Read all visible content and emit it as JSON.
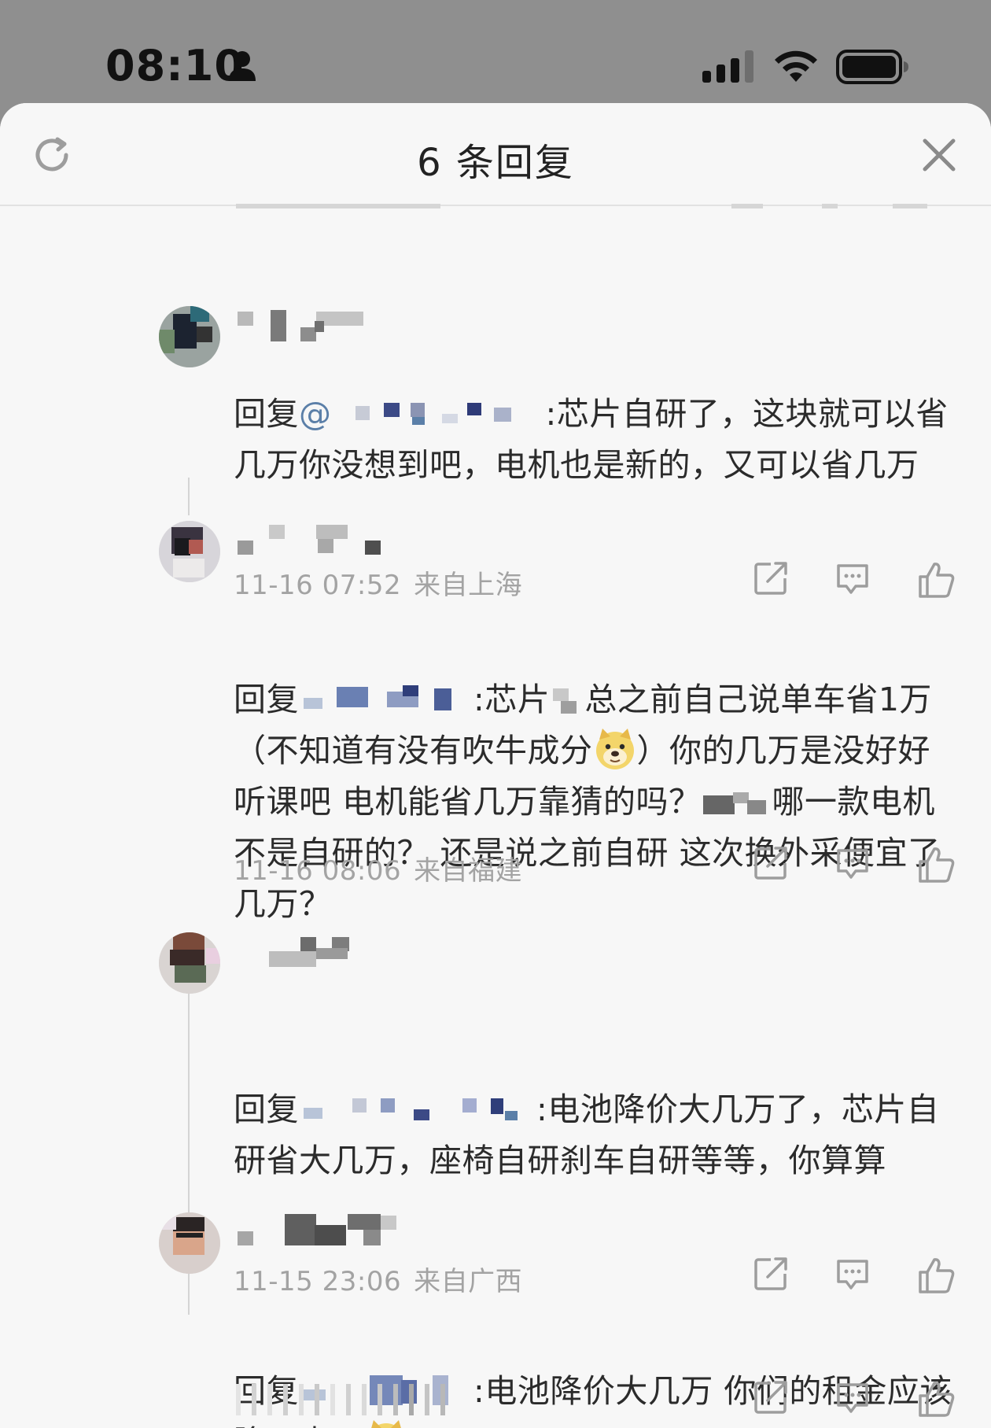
{
  "status_bar": {
    "time": "08:10"
  },
  "sheet": {
    "title": "6 条回复"
  },
  "comments": [
    {
      "reply_prefix": "回复",
      "mention_symbol": "@",
      "text": ":芯片自研了，这块就可以省几万你没想到吧，电机也是新的，又可以省几万",
      "time": "11-16 07:52",
      "location": "来自上海"
    },
    {
      "reply_prefix": "回复",
      "text_a": ":芯片",
      "text_b": "总之前自己说单车省1万（不知道有没有吹牛成分",
      "text_c": "）你的几万是没好好听课吧 电机能省几万靠猜的吗？",
      "text_d": "哪一款电机不是自研的？ 还是说之前自研 这次换外采便宜了几万？",
      "time": "11-16 08:06",
      "location": "来自福建"
    },
    {
      "reply_prefix": "回复",
      "text": ":电池降价大几万了，芯片自研省大几万，座椅自研刹车自研等等，你算算",
      "time": "11-15 23:06",
      "location": "来自广西"
    },
    {
      "reply_prefix": "回复",
      "text_a": ":电池降价大几万 你们的租金应该降不少吧",
      "time": "",
      "location": ""
    }
  ],
  "icons": {
    "refresh": "refresh-icon",
    "close": "close-icon",
    "share": "share-icon",
    "comment": "comment-icon",
    "like": "thumbs-up-icon",
    "emoji": "doge-emoji"
  },
  "colors": {
    "status_bar_bg": "#8f8f8f",
    "sheet_bg": "#f7f7f7",
    "meta_text": "#a3a3a3",
    "icon_gray": "#9d9d9d"
  }
}
